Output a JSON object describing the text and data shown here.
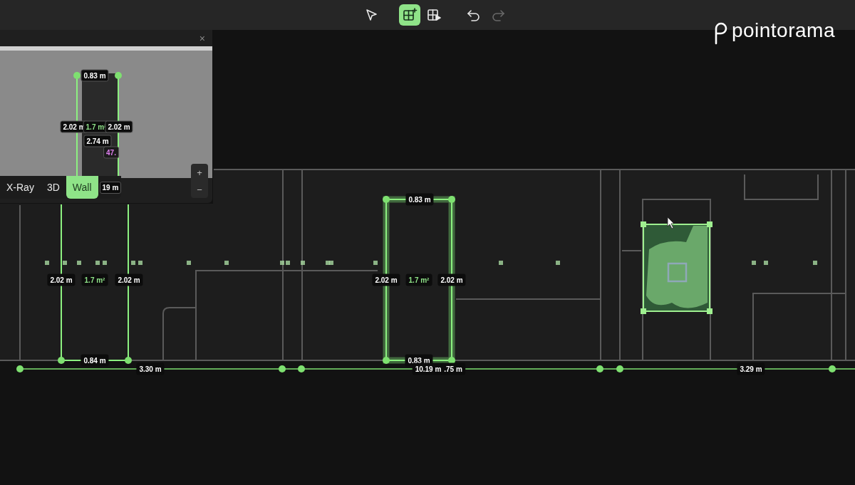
{
  "toolbar": {
    "tools": [
      {
        "kind": "select",
        "selected": false,
        "disabled": false
      },
      {
        "kind": "add-opening",
        "selected": true,
        "disabled": false
      },
      {
        "kind": "wall-view",
        "selected": false,
        "disabled": false
      },
      {
        "kind": "undo",
        "selected": false,
        "disabled": false
      },
      {
        "kind": "redo",
        "selected": false,
        "disabled": true
      }
    ]
  },
  "logo": {
    "text": "pointorama"
  },
  "minimap": {
    "close": "×",
    "labels": [
      {
        "text": "0.83 m",
        "kind": "length"
      },
      {
        "text": "2.02 m",
        "kind": "length"
      },
      {
        "text": "1.7 m²",
        "kind": "area"
      },
      {
        "text": "2.02 m",
        "kind": "length"
      },
      {
        "text": "2.74 m",
        "kind": "length"
      },
      {
        "text": "47.",
        "kind": "angle"
      },
      {
        "text": "19 m",
        "kind": "length"
      }
    ],
    "view_tabs": [
      {
        "label": "X-Ray",
        "selected": false
      },
      {
        "label": "3D",
        "selected": false
      },
      {
        "label": "Wall",
        "selected": true
      }
    ],
    "zoom_in": "+",
    "zoom_out": "−"
  },
  "openings": [
    {
      "kind": "door",
      "selected": false
    },
    {
      "kind": "door",
      "selected": true
    },
    {
      "kind": "window",
      "selected": false
    }
  ],
  "measurements": [
    {
      "text": "0.83 m",
      "kind": "length"
    },
    {
      "text": "2.02 m",
      "kind": "length"
    },
    {
      "text": "1.7 m²",
      "kind": "area"
    },
    {
      "text": "2.02 m",
      "kind": "length"
    },
    {
      "text": "0.84 m",
      "kind": "length"
    },
    {
      "text": "3.30 m",
      "kind": "length"
    },
    {
      "text": "2.02 m",
      "kind": "length"
    },
    {
      "text": "1.7 m²",
      "kind": "area"
    },
    {
      "text": "2.02 m",
      "kind": "length"
    },
    {
      "text": "0.83 m",
      "kind": "length"
    },
    {
      "text": "10.19 m",
      "kind": "length"
    },
    {
      "text": ".75 m",
      "kind": "length"
    },
    {
      "text": "3.29 m",
      "kind": "length"
    }
  ]
}
